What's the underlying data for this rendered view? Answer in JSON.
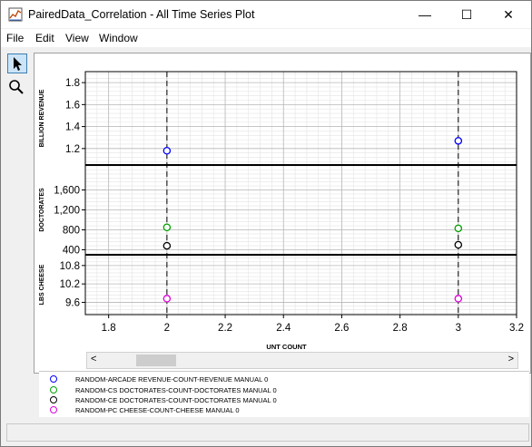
{
  "window": {
    "title": "PairedData_Correlation - All Time Series Plot",
    "minimize_glyph": "—",
    "maximize_glyph": "☐",
    "close_glyph": "✕"
  },
  "menu": {
    "items": [
      "File",
      "Edit",
      "View",
      "Window"
    ]
  },
  "toolbar": {
    "tools": [
      "select-pointer-icon",
      "zoom-magnifier-icon"
    ]
  },
  "chart_data": [
    {
      "type": "scatter",
      "panel": "top",
      "ylabel": "BILLION REVENUE",
      "ylim": [
        1.05,
        1.9
      ],
      "yticks": [
        1.2,
        1.4,
        1.6,
        1.8
      ],
      "ytick_labels": [
        "1.2",
        "1.4",
        "1.6",
        "1.8"
      ],
      "series": [
        {
          "name": "RANDOM-ARCADE REVENUE-COUNT-REVENUE MANUAL",
          "color": "#0000ff",
          "points": [
            [
              2,
              1.18
            ],
            [
              3,
              1.27
            ]
          ]
        }
      ]
    },
    {
      "type": "scatter",
      "panel": "middle",
      "ylabel": "DOCTORATES",
      "ylim": [
        300,
        2100
      ],
      "yticks": [
        400,
        800,
        1200,
        1600
      ],
      "ytick_labels": [
        "400",
        "800",
        "1,200",
        "1,600"
      ],
      "series": [
        {
          "name": "RANDOM-CS DOCTORATES-COUNT-DOCTORATES MANUAL",
          "color": "#00a000",
          "points": [
            [
              2,
              850
            ],
            [
              3,
              830
            ]
          ]
        },
        {
          "name": "RANDOM-CE DOCTORATES-COUNT-DOCTORATES MANUAL",
          "color": "#000000",
          "points": [
            [
              2,
              480
            ],
            [
              3,
              500
            ]
          ]
        }
      ]
    },
    {
      "type": "scatter",
      "panel": "bottom",
      "ylabel": "LBS CHEESE",
      "xlabel": "UNT COUNT",
      "ylim": [
        9.2,
        11.15
      ],
      "yticks": [
        9.6,
        10.2,
        10.8
      ],
      "ytick_labels": [
        "9.6",
        "10.2",
        "10.8"
      ],
      "xlim": [
        1.72,
        3.2
      ],
      "xticks": [
        1.8,
        2,
        2.2,
        2.4,
        2.6,
        2.8,
        3,
        3.2
      ],
      "xtick_labels": [
        "1.8",
        "2",
        "2.2",
        "2.4",
        "2.6",
        "2.8",
        "3",
        "3.2"
      ],
      "series": [
        {
          "name": "RANDOM-PC CHEESE-COUNT-CHEESE MANUAL",
          "color": "#e000e0",
          "points": [
            [
              2,
              9.72
            ],
            [
              3,
              9.72
            ]
          ]
        }
      ]
    }
  ],
  "markers": {
    "dashed_x": [
      2,
      3
    ]
  },
  "scrollbar": {
    "left_glyph": "<",
    "right_glyph": ">"
  },
  "legend": {
    "entries": [
      {
        "label": "RANDOM-ARCADE REVENUE-COUNT-REVENUE MANUAL  0",
        "color": "#0000ff"
      },
      {
        "label": "RANDOM-CS DOCTORATES-COUNT-DOCTORATES MANUAL  0",
        "color": "#00a000"
      },
      {
        "label": "RANDOM-CE DOCTORATES-COUNT-DOCTORATES MANUAL  0",
        "color": "#000000"
      },
      {
        "label": "RANDOM-PC CHEESE-COUNT-CHEESE MANUAL  0",
        "color": "#e000e0"
      }
    ]
  }
}
